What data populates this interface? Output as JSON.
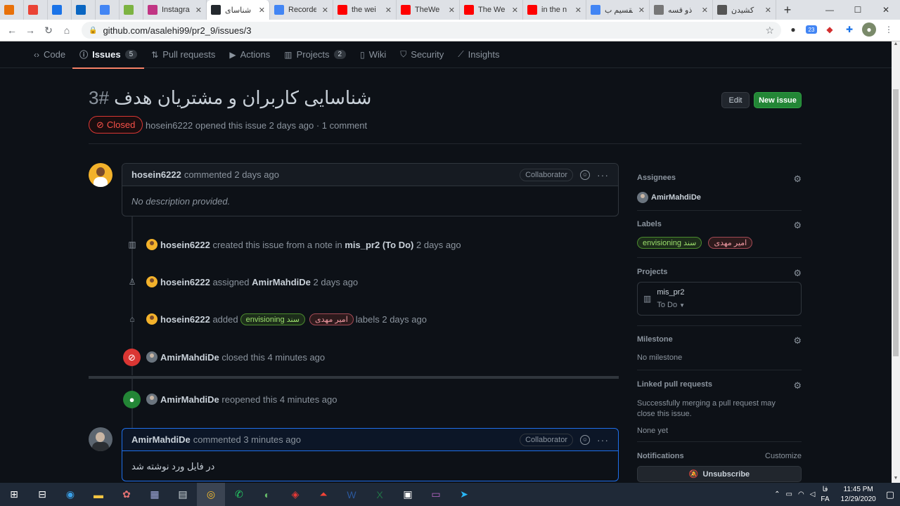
{
  "browser": {
    "tabs": [
      {
        "title": "",
        "icon": "bookmark-icon",
        "color": "#e8710a"
      },
      {
        "title": "",
        "icon": "gmail-icon",
        "color": "#ea4335"
      },
      {
        "title": "",
        "icon": "app-icon",
        "color": "#1a73e8"
      },
      {
        "title": "",
        "icon": "linkedin-icon",
        "color": "#0a66c2"
      },
      {
        "title": "",
        "icon": "translate-icon",
        "color": "#4285f4"
      },
      {
        "title": "",
        "icon": "pen-icon",
        "color": "#7cb342"
      },
      {
        "title": "Instagra",
        "icon": "instagram-icon",
        "color": "#c13584"
      },
      {
        "title": "شناسای",
        "icon": "github-icon",
        "color": "#24292e",
        "active": true
      },
      {
        "title": "Recorde",
        "icon": "record-icon",
        "color": "#4285f4"
      },
      {
        "title": "the wei",
        "icon": "youtube-icon",
        "color": "#ff0000"
      },
      {
        "title": "TheWe",
        "icon": "youtube-icon",
        "color": "#ff0000"
      },
      {
        "title": "The We",
        "icon": "youtube-icon",
        "color": "#ff0000"
      },
      {
        "title": "in the n",
        "icon": "youtube-icon",
        "color": "#ff0000"
      },
      {
        "title": "تقسیم ب",
        "icon": "google-icon",
        "color": "#4285f4"
      },
      {
        "title": "ذو قسه",
        "icon": "site-icon",
        "color": "#777777"
      },
      {
        "title": "کشیدن",
        "icon": "eye-icon",
        "color": "#555555"
      }
    ],
    "url": "github.com/asalehi99/pr2_9/issues/3",
    "ext_badge": "23"
  },
  "repo_nav": [
    {
      "label": "Code",
      "icon": "code-icon"
    },
    {
      "label": "Issues",
      "icon": "issue-icon",
      "count": "5",
      "selected": true
    },
    {
      "label": "Pull requests",
      "icon": "pull-request-icon"
    },
    {
      "label": "Actions",
      "icon": "play-icon"
    },
    {
      "label": "Projects",
      "icon": "project-icon",
      "count": "2"
    },
    {
      "label": "Wiki",
      "icon": "book-icon"
    },
    {
      "label": "Security",
      "icon": "shield-icon"
    },
    {
      "label": "Insights",
      "icon": "graph-icon"
    }
  ],
  "issue": {
    "title": "شناسایی کاربران و مشتریان هدف",
    "number": "#3",
    "state": "Closed",
    "author": "hosein6222",
    "meta_rest": "opened this issue 2 days ago · 1 comment",
    "edit_label": "Edit",
    "new_label": "New issue"
  },
  "first_comment": {
    "author": "hosein6222",
    "time": "commented 2 days ago",
    "badge": "Collaborator",
    "body": "No description provided."
  },
  "events": {
    "e1": {
      "actor": "hosein6222",
      "text1": "created this issue from a note in",
      "project": "mis_pr2",
      "text2": "(To Do)",
      "time": "2 days ago"
    },
    "e2": {
      "actor": "hosein6222",
      "text1": "assigned",
      "target": "AmirMahdiDe",
      "time": "2 days ago"
    },
    "e3": {
      "actor": "hosein6222",
      "text1": "added",
      "label1": "envisioning سند",
      "label2": "امیر مهدی",
      "text2": "labels",
      "time": "2 days ago"
    },
    "e4": {
      "actor": "AmirMahdiDe",
      "text1": "closed this",
      "time": "4 minutes ago"
    },
    "e5": {
      "actor": "AmirMahdiDe",
      "text1": "reopened this",
      "time": "4 minutes ago"
    }
  },
  "second_comment": {
    "author": "AmirMahdiDe",
    "time": "commented 3 minutes ago",
    "badge": "Collaborator",
    "body": "در فایل ورد نوشته شد"
  },
  "sidebar": {
    "assignees_h": "Assignees",
    "assignee": "AmirMahdiDe",
    "labels_h": "Labels",
    "label1": "envisioning سند",
    "label2": "امیر مهدی",
    "projects_h": "Projects",
    "project_name": "mis_pr2",
    "project_col": "To Do",
    "milestone_h": "Milestone",
    "milestone_v": "No milestone",
    "linked_h": "Linked pull requests",
    "linked_v": "Successfully merging a pull request may close this issue.",
    "linked_none": "None yet",
    "notif_h": "Notifications",
    "notif_custom": "Customize",
    "unsubscribe": "Unsubscribe"
  },
  "taskbar": {
    "lang": "FA",
    "lang_sub": "فا",
    "time": "11:45 PM",
    "date": "12/29/2020"
  },
  "colors": {
    "accent": "#238636",
    "closed": "#da3633",
    "open": "#238636",
    "tab_underline": "#f78166"
  }
}
